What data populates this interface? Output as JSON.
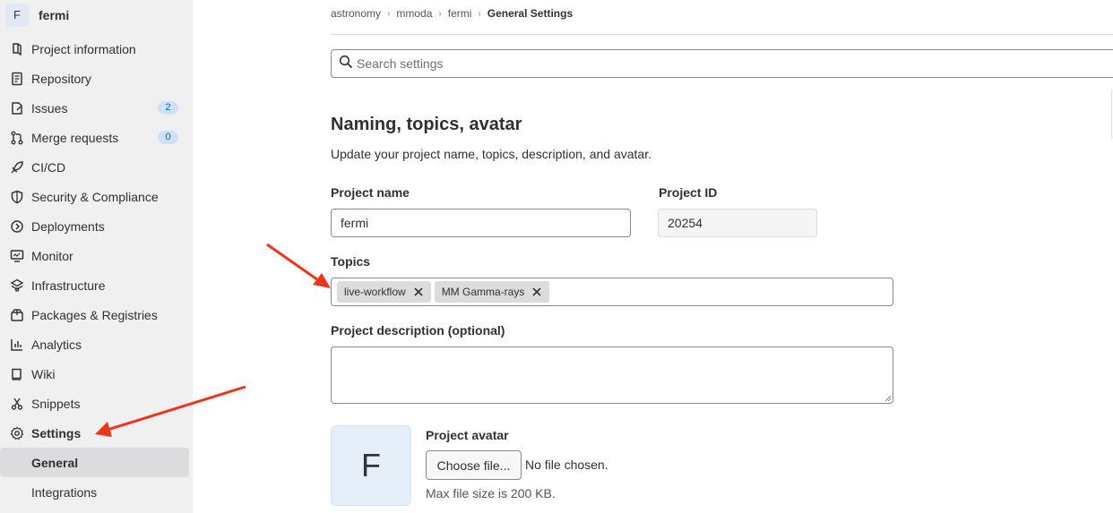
{
  "project": {
    "avatar_letter": "F",
    "name": "fermi"
  },
  "sidebar": {
    "items": [
      {
        "label": "Project information",
        "icon": "project-information-icon"
      },
      {
        "label": "Repository",
        "icon": "repository-icon"
      },
      {
        "label": "Issues",
        "icon": "issues-icon",
        "badge": "2"
      },
      {
        "label": "Merge requests",
        "icon": "merge-requests-icon",
        "badge": "0"
      },
      {
        "label": "CI/CD",
        "icon": "rocket-icon"
      },
      {
        "label": "Security & Compliance",
        "icon": "shield-icon"
      },
      {
        "label": "Deployments",
        "icon": "deployments-icon"
      },
      {
        "label": "Monitor",
        "icon": "monitor-icon"
      },
      {
        "label": "Infrastructure",
        "icon": "infrastructure-icon"
      },
      {
        "label": "Packages & Registries",
        "icon": "package-icon"
      },
      {
        "label": "Analytics",
        "icon": "analytics-icon"
      },
      {
        "label": "Wiki",
        "icon": "book-icon"
      },
      {
        "label": "Snippets",
        "icon": "snippet-icon"
      },
      {
        "label": "Settings",
        "icon": "gear-icon"
      }
    ],
    "sub_items": [
      {
        "label": "General",
        "current": true
      },
      {
        "label": "Integrations",
        "current": false
      }
    ]
  },
  "breadcrumb": [
    "astronomy",
    "mmoda",
    "fermi",
    "General Settings"
  ],
  "search": {
    "placeholder": "Search settings",
    "value": ""
  },
  "section": {
    "title": "Naming, topics, avatar",
    "description": "Update your project name, topics, description, and avatar."
  },
  "form": {
    "project_name_label": "Project name",
    "project_name_value": "fermi",
    "project_id_label": "Project ID",
    "project_id_value": "20254",
    "topics_label": "Topics",
    "topics": [
      "live-workflow",
      "MM Gamma-rays"
    ],
    "description_label": "Project description (optional)",
    "description_value": "",
    "avatar_label": "Project avatar",
    "avatar_letter": "F",
    "choose_file_label": "Choose file...",
    "file_status": "No file chosen.",
    "max_size_help": "Max file size is 200 KB."
  },
  "colors": {
    "annotation_arrow": "#f0341c",
    "badge_bg": "#cbe2f9",
    "sidebar_bg": "#f0f0f0"
  }
}
